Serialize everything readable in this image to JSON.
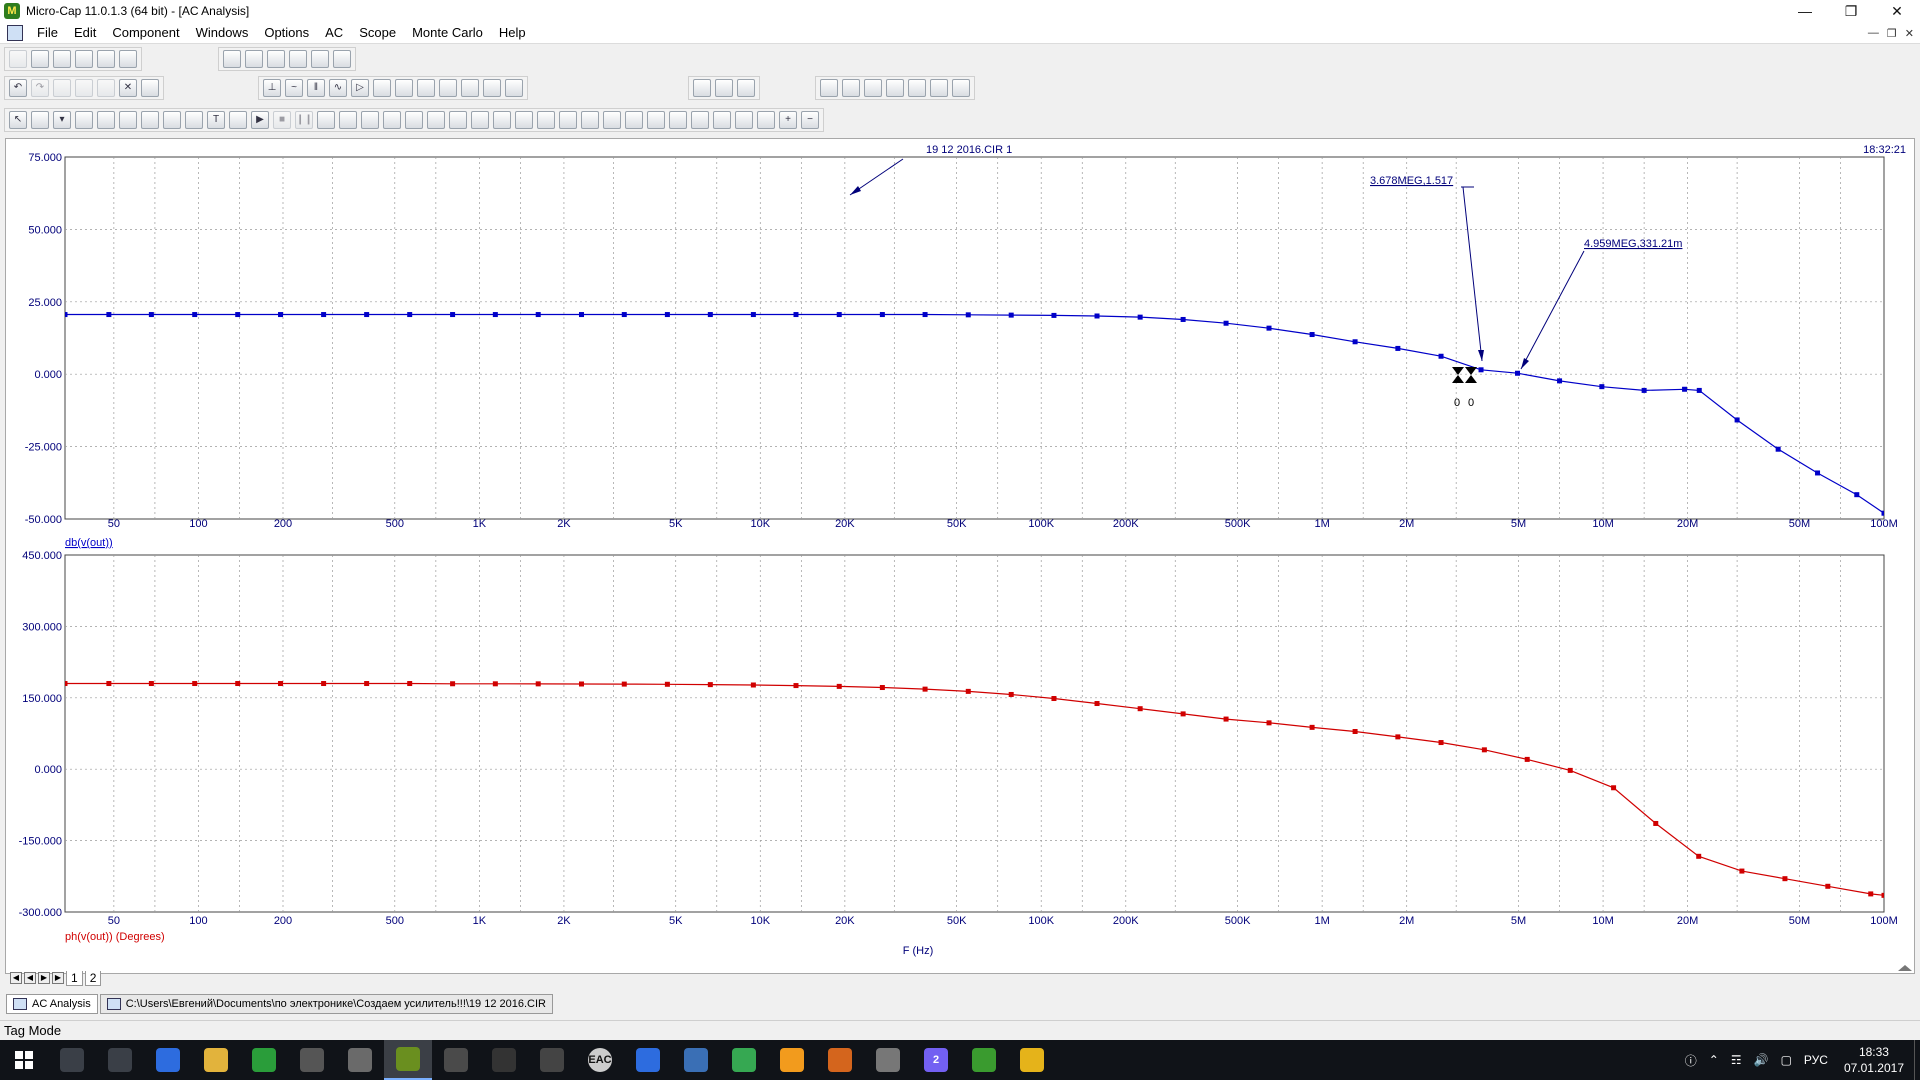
{
  "window": {
    "title": "Micro-Cap 11.0.1.3 (64 bit) - [AC Analysis]",
    "app_icon": "micro-cap-icon",
    "controls": [
      "minimize-icon",
      "restore-icon",
      "close-icon"
    ]
  },
  "menu": {
    "items": [
      "File",
      "Edit",
      "Component",
      "Windows",
      "Options",
      "AC",
      "Scope",
      "Monte Carlo",
      "Help"
    ]
  },
  "plot": {
    "circuit_label": "19 12 2016.CIR 1",
    "time": "18:32:21",
    "x_axis_title": "F (Hz)",
    "top": {
      "trace_label": "db(v(out))",
      "color": "#0000c8",
      "y_ticks": [
        "75.000",
        "50.000",
        "25.000",
        "0.000",
        "-25.000",
        "-50.000"
      ],
      "annotations": [
        "3.678MEG,1.517",
        "4.959MEG,331.21m"
      ],
      "cursor_labels": [
        "0",
        "0"
      ]
    },
    "bottom": {
      "trace_label": "ph(v(out)) (Degrees)",
      "color": "#d00000",
      "y_ticks": [
        "450.000",
        "300.000",
        "150.000",
        "0.000",
        "-150.000",
        "-300.000"
      ]
    },
    "x_ticks": [
      "50",
      "100",
      "200",
      "500",
      "1K",
      "2K",
      "5K",
      "10K",
      "20K",
      "50K",
      "100K",
      "200K",
      "500K",
      "1M",
      "2M",
      "5M",
      "10M",
      "20M",
      "50M",
      "100M"
    ]
  },
  "chart_data": [
    {
      "type": "line",
      "title": "",
      "xlabel": "F (Hz)",
      "ylabel": "db(v(out))",
      "xscale": "log",
      "xlim": [
        33.5,
        100000000
      ],
      "ylim": [
        -50,
        75
      ],
      "grid": true,
      "series": [
        {
          "name": "db(v(out))",
          "x": [
            33.5,
            48,
            68,
            97,
            138,
            196,
            279,
            397,
            565,
            803,
            1140,
            1620,
            2310,
            3280,
            4670,
            6640,
            9450,
            13400,
            19100,
            27200,
            38600,
            55000,
            78200,
            111000,
            158000,
            225000,
            320000,
            455000,
            647000,
            921000,
            1310000,
            1860000,
            2650000,
            3678000,
            4959000,
            7000000,
            9900000,
            14000000,
            19500000,
            22000000,
            30000000,
            42000000,
            58000000,
            80000000,
            100000000
          ],
          "values": [
            20.6,
            20.6,
            20.6,
            20.6,
            20.6,
            20.6,
            20.6,
            20.6,
            20.6,
            20.6,
            20.6,
            20.6,
            20.6,
            20.6,
            20.6,
            20.6,
            20.6,
            20.6,
            20.6,
            20.6,
            20.6,
            20.5,
            20.4,
            20.3,
            20.1,
            19.7,
            18.9,
            17.6,
            15.9,
            13.7,
            11.2,
            8.9,
            6.2,
            1.517,
            0.331,
            -2.3,
            -4.3,
            -5.6,
            -5.2,
            -5.6,
            -15.8,
            -25.9,
            -34.1,
            -41.6,
            -48.0
          ]
        }
      ]
    },
    {
      "type": "line",
      "title": "",
      "xlabel": "F (Hz)",
      "ylabel": "ph(v(out)) (Degrees)",
      "xscale": "log",
      "xlim": [
        33.5,
        100000000
      ],
      "ylim": [
        -300,
        450
      ],
      "grid": true,
      "series": [
        {
          "name": "ph(v(out)) (Degrees)",
          "x": [
            33.5,
            48,
            68,
            97,
            138,
            196,
            279,
            397,
            565,
            803,
            1140,
            1620,
            2310,
            3280,
            4670,
            6640,
            9450,
            13400,
            19100,
            27200,
            38600,
            55000,
            78200,
            111000,
            158000,
            225000,
            320000,
            455000,
            647000,
            921000,
            1310000,
            1860000,
            2650000,
            3780000,
            5370000,
            7640000,
            10900000,
            15400000,
            21900000,
            31200000,
            44400000,
            63100000,
            89700000,
            100000000
          ],
          "values": [
            180,
            180,
            180,
            180,
            180,
            180,
            180,
            180,
            180,
            179.5,
            179.4,
            179.3,
            179,
            178.8,
            178.4,
            177.7,
            176.9,
            175.7,
            174,
            171.6,
            168.2,
            163.5,
            157,
            148.5,
            138,
            127.1,
            116.2,
            105.3,
            97.4,
            87.9,
            79.2,
            67.9,
            56,
            40.7,
            20.6,
            -2.5,
            -39,
            -114,
            -183,
            -214,
            -230,
            -246,
            -262,
            -265
          ]
        }
      ]
    }
  ],
  "page_tabs": [
    "1",
    "2"
  ],
  "doc_tabs": [
    {
      "label": "AC Analysis",
      "active": true
    },
    {
      "label": "C:\\Users\\Евгений\\Documents\\по электронике\\Создаем усилитель!!!\\19 12 2016.CIR",
      "active": false
    }
  ],
  "status": {
    "mode": "Tag Mode"
  },
  "taskbar": {
    "apps": [
      {
        "icon": "search-icon",
        "label": ""
      },
      {
        "icon": "task-view-icon",
        "label": ""
      },
      {
        "icon": "explorer-icon",
        "label": ""
      },
      {
        "icon": "folder-icon",
        "label": ""
      },
      {
        "icon": "network-icon",
        "label": ""
      },
      {
        "icon": "calculator-icon",
        "label": ""
      },
      {
        "icon": "chart-icon",
        "label": ""
      },
      {
        "icon": "micro-cap-icon",
        "label": ""
      },
      {
        "icon": "phone-icon",
        "label": ""
      },
      {
        "icon": "media-icon",
        "label": ""
      },
      {
        "icon": "fl-icon",
        "label": ""
      },
      {
        "icon": "eac-icon",
        "label": "EAC"
      },
      {
        "icon": "diamond-icon",
        "label": ""
      },
      {
        "icon": "flower-icon",
        "label": ""
      },
      {
        "icon": "globe-icon",
        "label": ""
      },
      {
        "icon": "clock-app-icon",
        "label": ""
      },
      {
        "icon": "archive-icon",
        "label": ""
      },
      {
        "icon": "doc-icon",
        "label": ""
      },
      {
        "icon": "viber-icon",
        "label": "2"
      },
      {
        "icon": "utorrent-icon",
        "label": ""
      },
      {
        "icon": "chrome-icon",
        "label": ""
      }
    ],
    "tray": {
      "lang": "РУС",
      "time": "18:33",
      "date": "07.01.2017"
    }
  }
}
